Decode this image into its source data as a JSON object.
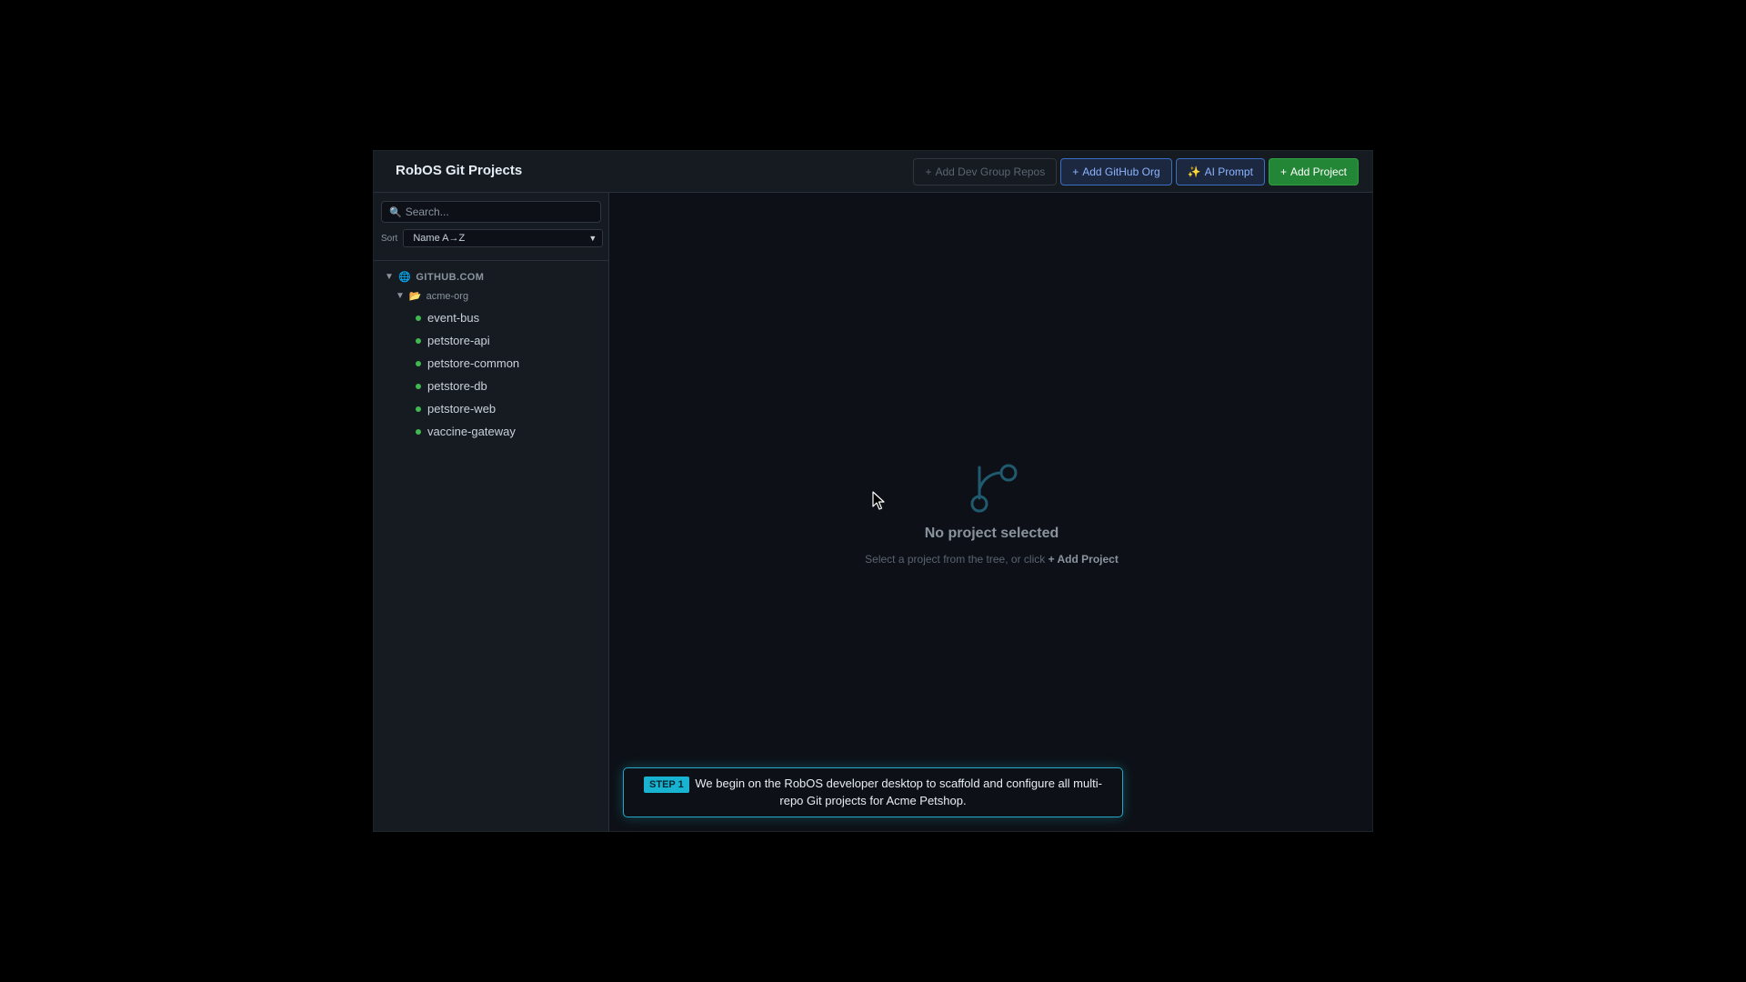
{
  "app": {
    "title": "RobOS Git Projects"
  },
  "toolbar": {
    "add_dev_group": "Add Dev Group Repos",
    "add_github_org": "Add GitHub Org",
    "ai_prompt": "AI Prompt",
    "add_project": "Add Project"
  },
  "sidebar": {
    "search_placeholder": "Search...",
    "sort_label": "Sort",
    "sort_value": "Name A→Z",
    "host": "GITHUB.COM",
    "org": "acme-org",
    "repos": [
      "event-bus",
      "petstore-api",
      "petstore-common",
      "petstore-db",
      "petstore-web",
      "vaccine-gateway"
    ]
  },
  "empty_state": {
    "title": "No project selected",
    "subtitle": "Select a project from the tree, or click",
    "link": "Add Project"
  },
  "step": {
    "badge": "STEP 1",
    "text": "We begin on the RobOS developer desktop to scaffold and configure all multi-repo Git projects for Acme Petshop."
  },
  "colors": {
    "accent_green": "#238636",
    "accent_blue": "#3b6fc4",
    "status_dot": "#3fb950",
    "step_accent": "#17b3d0"
  },
  "icons": {
    "search": "search-icon",
    "globe": "globe-icon",
    "folder": "folder-open-icon",
    "branch": "git-branch-icon",
    "sparkles": "sparkles-icon"
  }
}
